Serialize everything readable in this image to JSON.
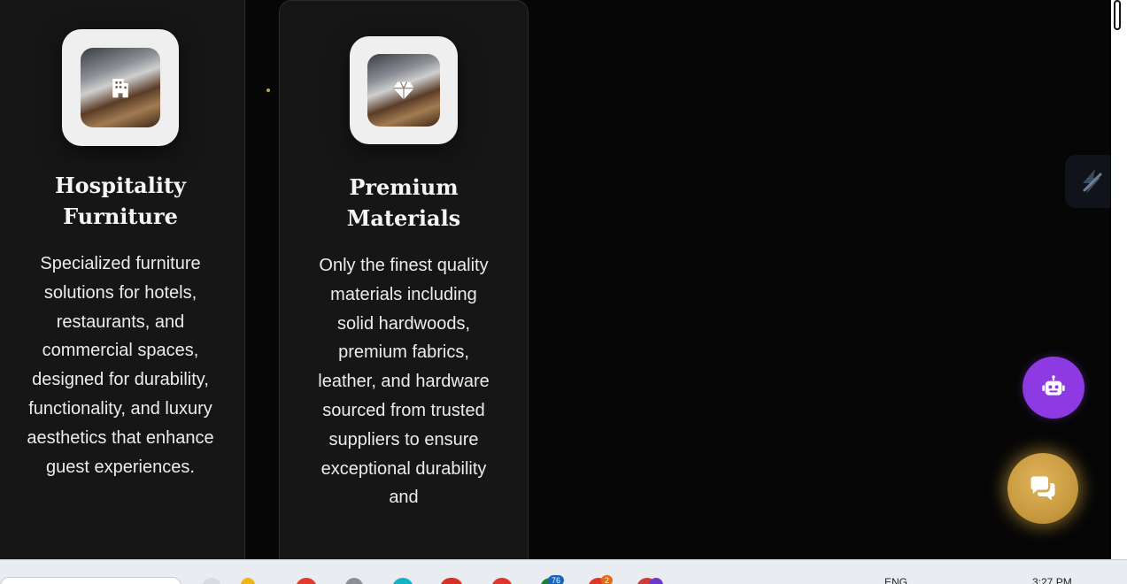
{
  "cards": [
    {
      "icon": "hotel-building-icon",
      "title": "Hospitality Furniture",
      "description": "Specialized furniture solutions for hotels, restaurants, and commercial spaces, designed for durability, functionality, and luxury aesthetics that enhance guest experiences."
    },
    {
      "icon": "diamond-icon",
      "title": "Premium Materials",
      "description": "Only the finest quality materials including solid hardwoods, premium fabrics, leather, and hardware sourced from trusted suppliers to ensure exceptional durability and"
    }
  ],
  "floating_buttons": {
    "assistant": {
      "icon": "robot-icon"
    },
    "chat": {
      "icon": "chat-bubbles-icon"
    }
  },
  "side_widget": {
    "icon": "lightning-slash-icon"
  },
  "colors": {
    "background": "#060606",
    "card": "#161616",
    "accent_gold": "#c99a3f",
    "accent_purple": "#8e3ae3"
  },
  "taskbar": {
    "language": "ENG",
    "time": "3:27 PM",
    "badges": [
      "76",
      "2"
    ]
  }
}
